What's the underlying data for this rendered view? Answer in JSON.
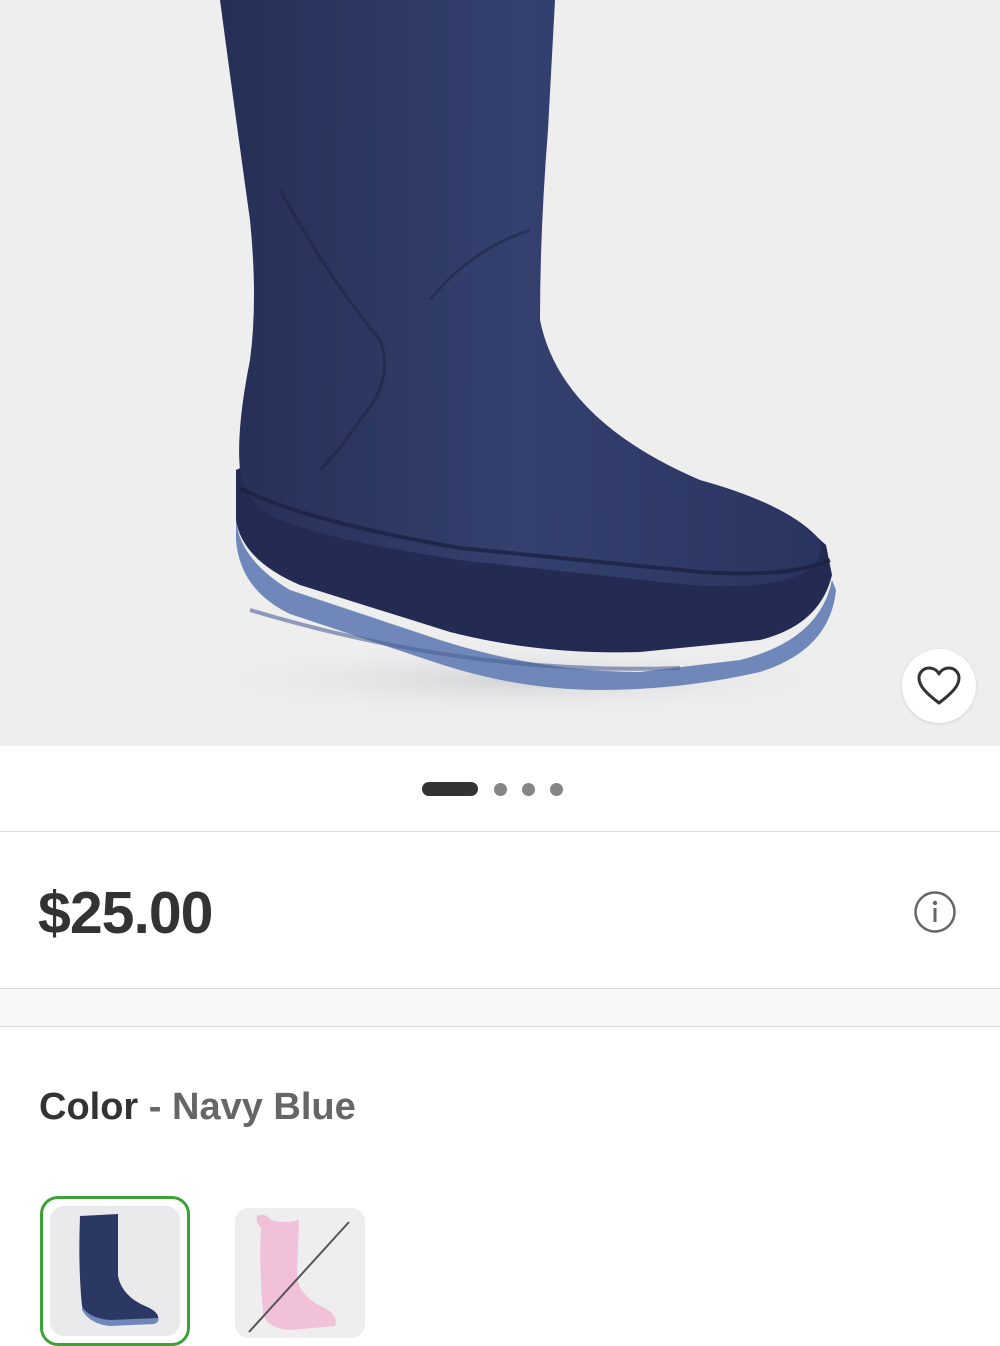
{
  "product": {
    "image_alt": "Navy blue rain boot",
    "carousel": {
      "total": 4,
      "active_index": 0
    },
    "price": "$25.00",
    "color": {
      "label": "Color",
      "separator": "-",
      "selected": "Navy Blue",
      "options": [
        {
          "name": "Navy Blue",
          "selected": true,
          "available": true,
          "hex": "#2b3863"
        },
        {
          "name": "Pink",
          "selected": false,
          "available": false,
          "hex": "#f1c1d9"
        }
      ]
    }
  },
  "icons": {
    "favorite": "heart-outline-icon",
    "info": "info-circle-icon"
  },
  "colors": {
    "selected_ring": "#3ba336",
    "boot_navy": "#2b3863",
    "sole_blue": "#6f87b9"
  }
}
